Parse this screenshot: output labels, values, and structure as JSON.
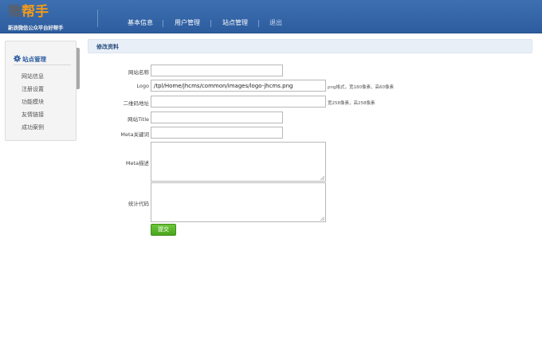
{
  "header": {
    "logo_text_1": "微",
    "logo_text_2": "帮手",
    "logo_sub": "新浪微信公众平台好帮手",
    "nav": [
      {
        "label": "基本信息"
      },
      {
        "label": "用户管理"
      },
      {
        "label": "站点管理"
      },
      {
        "label": "退出"
      }
    ]
  },
  "sidebar": {
    "title": "站点管理",
    "title_icon": "gear-icon",
    "items": [
      {
        "label": "网站信息"
      },
      {
        "label": "注册设置"
      },
      {
        "label": "功能模块"
      },
      {
        "label": "友情链接"
      },
      {
        "label": "成功案例"
      }
    ]
  },
  "panel": {
    "title": "修改资料"
  },
  "form": {
    "site_name": {
      "label": "网站名称",
      "value": ""
    },
    "logo": {
      "label": "Logo",
      "value": "/tpl/Home/jhcms/common/images/logo-jhcms.png",
      "hint": "png格式，宽180像素，高60像素"
    },
    "qrcode": {
      "label": "二维码地址",
      "value": "",
      "hint": "宽258像素，高258像素"
    },
    "site_title": {
      "label": "网站Title",
      "value": ""
    },
    "meta_keywords": {
      "label": "Meta关键词",
      "value": ""
    },
    "meta_description": {
      "label": "Meta描述",
      "value": ""
    },
    "stats_code": {
      "label": "统计代码",
      "value": ""
    },
    "submit_label": "提交"
  },
  "colors": {
    "header_bg": "#2d5d9f",
    "accent_orange": "#f39a16",
    "submit_green": "#4aa51e",
    "panel_head_bg": "#e9eff7"
  }
}
